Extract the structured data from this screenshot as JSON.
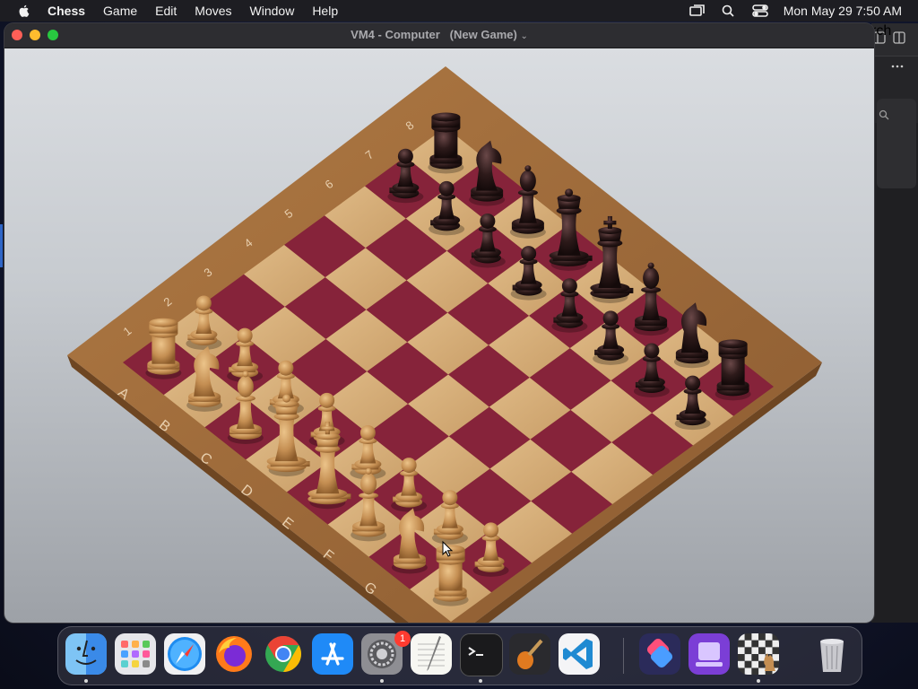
{
  "menubar": {
    "app_name": "Chess",
    "items": [
      "Game",
      "Edit",
      "Moves",
      "Window",
      "Help"
    ],
    "clock": "Mon May 29  7:50 AM"
  },
  "window": {
    "title": "VM4 - Computer   (New Game)",
    "title_chevron": "⌄"
  },
  "board": {
    "rank_labels": [
      "8",
      "7",
      "6",
      "5",
      "4",
      "3",
      "2",
      "1"
    ],
    "file_labels": [
      "A",
      "B",
      "C",
      "D",
      "E",
      "F",
      "G"
    ],
    "colors": {
      "light_square": "#d7b27e",
      "dark_square": "#86233a",
      "frame": "#9a6a3c",
      "white_piece": "#c9955a",
      "black_piece": "#2c1818"
    }
  },
  "background_window": {
    "search_label": "rch"
  },
  "dock": {
    "apps": [
      {
        "name": "Finder",
        "icon": "finder-icon"
      },
      {
        "name": "Launchpad",
        "icon": "launchpad-icon"
      },
      {
        "name": "Safari",
        "icon": "safari-icon"
      },
      {
        "name": "Firefox",
        "icon": "firefox-icon"
      },
      {
        "name": "Chrome",
        "icon": "chrome-icon"
      },
      {
        "name": "App Store",
        "icon": "app-store-icon"
      },
      {
        "name": "System Settings",
        "icon": "settings-icon",
        "badge": "1"
      },
      {
        "name": "TextEdit",
        "icon": "textedit-icon"
      },
      {
        "name": "Terminal",
        "icon": "terminal-icon"
      },
      {
        "name": "GarageBand",
        "icon": "garageband-icon"
      },
      {
        "name": "VS Code",
        "icon": "vscode-icon"
      },
      {
        "name": "Shortcuts",
        "icon": "shortcuts-icon"
      },
      {
        "name": "Simulator",
        "icon": "simulator-icon"
      },
      {
        "name": "Chess",
        "icon": "chess-app-icon"
      },
      {
        "name": "Trash",
        "icon": "trash-icon"
      }
    ]
  }
}
